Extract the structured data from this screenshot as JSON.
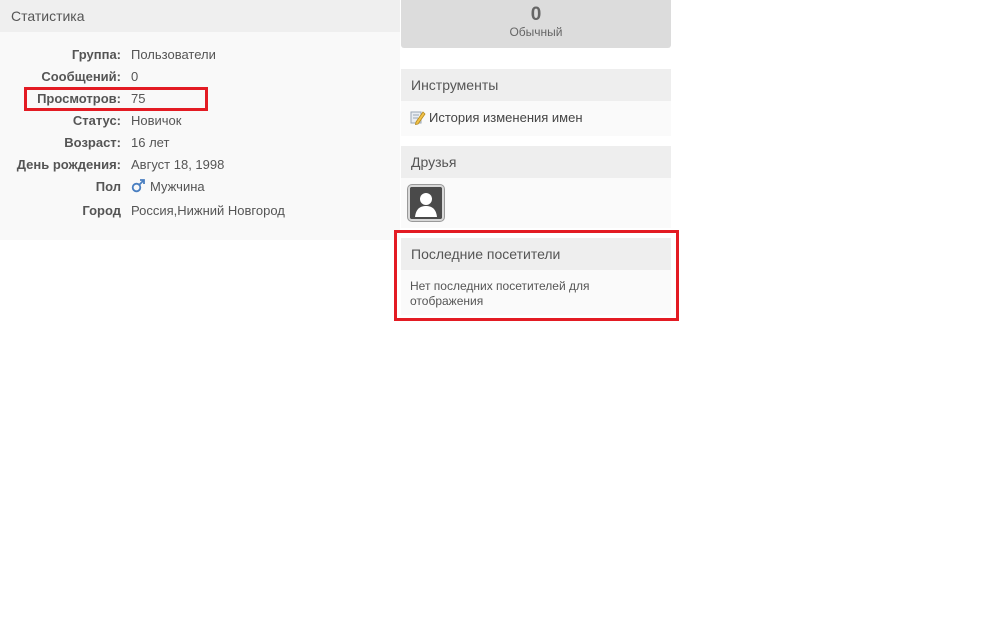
{
  "stats": {
    "title": "Статистика",
    "rows": [
      {
        "label": "Группа:",
        "value": "Пользователи"
      },
      {
        "label": "Сообщений:",
        "value": "0"
      },
      {
        "label": "Просмотров:",
        "value": "75"
      },
      {
        "label": "Статус:",
        "value": "Новичок"
      },
      {
        "label": "Возраст:",
        "value": "16 лет"
      },
      {
        "label": "День рождения:",
        "value": "Август 18, 1998"
      },
      {
        "label": "Пол",
        "value": "Мужчина",
        "icon": "male-gender-icon"
      },
      {
        "label": "Город",
        "value": "Россия,Нижний Новгород"
      }
    ]
  },
  "reputation": {
    "value": "0",
    "label": "Обычный"
  },
  "tools": {
    "title": "Инструменты",
    "link": "История изменения имен",
    "icon": "pencil-edit-icon"
  },
  "friends": {
    "title": "Друзья",
    "avatar_icon": "user-silhouette-icon"
  },
  "visitors": {
    "title": "Последние посетители",
    "empty_text": "Нет последних посетителей для отображения"
  },
  "colors": {
    "highlight": "#e31b23",
    "header_bg": "#efefef",
    "panel_bg": "#f9f9f9"
  }
}
